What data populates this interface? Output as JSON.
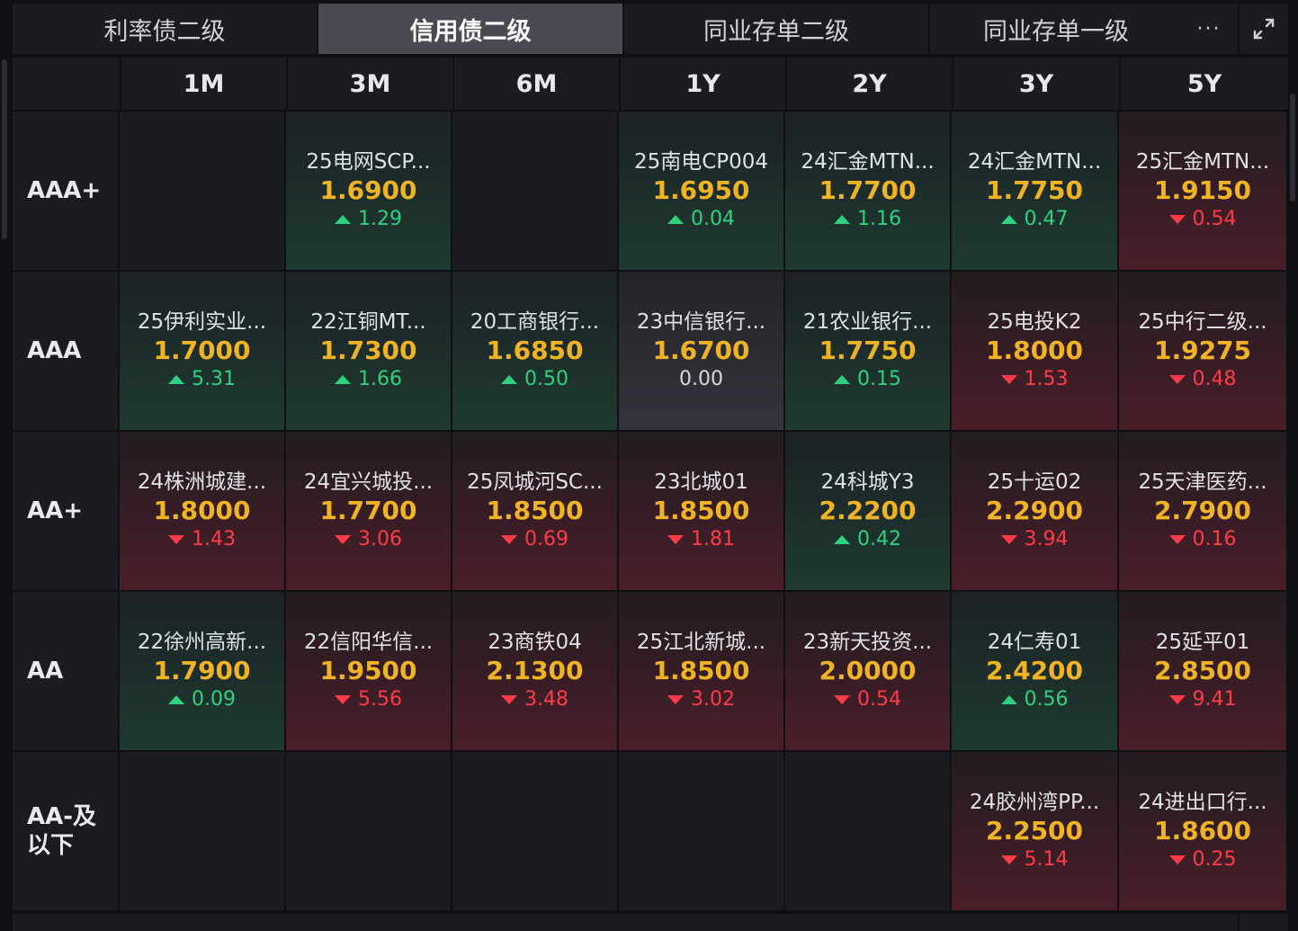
{
  "tabs": [
    {
      "label": "利率债二级",
      "active": false
    },
    {
      "label": "信用债二级",
      "active": true
    },
    {
      "label": "同业存单二级",
      "active": false
    },
    {
      "label": "同业存单一级",
      "active": false
    }
  ],
  "tab_more": "···",
  "tenors": [
    "1M",
    "3M",
    "6M",
    "1Y",
    "2Y",
    "3Y",
    "5Y"
  ],
  "rows": [
    {
      "label": "AAA+",
      "cells": [
        null,
        {
          "bond": "25电网SCP...",
          "yield": "1.6900",
          "change": "1.29",
          "dir": "up"
        },
        null,
        {
          "bond": "25南电CP004",
          "yield": "1.6950",
          "change": "0.04",
          "dir": "up"
        },
        {
          "bond": "24汇金MTN...",
          "yield": "1.7700",
          "change": "1.16",
          "dir": "up"
        },
        {
          "bond": "24汇金MTN...",
          "yield": "1.7750",
          "change": "0.47",
          "dir": "up"
        },
        {
          "bond": "25汇金MTN...",
          "yield": "1.9150",
          "change": "0.54",
          "dir": "down"
        }
      ]
    },
    {
      "label": "AAA",
      "cells": [
        {
          "bond": "25伊利实业...",
          "yield": "1.7000",
          "change": "5.31",
          "dir": "up"
        },
        {
          "bond": "22江铜MT...",
          "yield": "1.7300",
          "change": "1.66",
          "dir": "up"
        },
        {
          "bond": "20工商银行...",
          "yield": "1.6850",
          "change": "0.50",
          "dir": "up"
        },
        {
          "bond": "23中信银行...",
          "yield": "1.6700",
          "change": "0.00",
          "dir": "flat"
        },
        {
          "bond": "21农业银行...",
          "yield": "1.7750",
          "change": "0.15",
          "dir": "up"
        },
        {
          "bond": "25电投K2",
          "yield": "1.8000",
          "change": "1.53",
          "dir": "down"
        },
        {
          "bond": "25中行二级...",
          "yield": "1.9275",
          "change": "0.48",
          "dir": "down"
        }
      ]
    },
    {
      "label": "AA+",
      "cells": [
        {
          "bond": "24株洲城建...",
          "yield": "1.8000",
          "change": "1.43",
          "dir": "down"
        },
        {
          "bond": "24宜兴城投...",
          "yield": "1.7700",
          "change": "3.06",
          "dir": "down"
        },
        {
          "bond": "25凤城河SC...",
          "yield": "1.8500",
          "change": "0.69",
          "dir": "down"
        },
        {
          "bond": "23北城01",
          "yield": "1.8500",
          "change": "1.81",
          "dir": "down"
        },
        {
          "bond": "24科城Y3",
          "yield": "2.2200",
          "change": "0.42",
          "dir": "up"
        },
        {
          "bond": "25十运02",
          "yield": "2.2900",
          "change": "3.94",
          "dir": "down"
        },
        {
          "bond": "25天津医药...",
          "yield": "2.7900",
          "change": "0.16",
          "dir": "down"
        }
      ]
    },
    {
      "label": "AA",
      "cells": [
        {
          "bond": "22徐州高新...",
          "yield": "1.7900",
          "change": "0.09",
          "dir": "up"
        },
        {
          "bond": "22信阳华信...",
          "yield": "1.9500",
          "change": "5.56",
          "dir": "down"
        },
        {
          "bond": "23商铁04",
          "yield": "2.1300",
          "change": "3.48",
          "dir": "down"
        },
        {
          "bond": "25江北新城...",
          "yield": "1.8500",
          "change": "3.02",
          "dir": "down"
        },
        {
          "bond": "23新天投资...",
          "yield": "2.0000",
          "change": "0.54",
          "dir": "down"
        },
        {
          "bond": "24仁寿01",
          "yield": "2.4200",
          "change": "0.56",
          "dir": "up"
        },
        {
          "bond": "25延平01",
          "yield": "2.8500",
          "change": "9.41",
          "dir": "down"
        }
      ]
    },
    {
      "label": "AA-及以下",
      "cells": [
        null,
        null,
        null,
        null,
        null,
        {
          "bond": "24胶州湾PP...",
          "yield": "2.2500",
          "change": "5.14",
          "dir": "down"
        },
        {
          "bond": "24进出口行...",
          "yield": "1.8600",
          "change": "0.25",
          "dir": "down"
        }
      ]
    }
  ],
  "colors": {
    "yield": "#f0b323",
    "up": "#2fd17f",
    "down": "#ff3b4a"
  },
  "icons": {
    "more": "more-dots-icon",
    "expand": "expand-icon",
    "up": "triangle-up-icon",
    "down": "triangle-down-icon"
  }
}
